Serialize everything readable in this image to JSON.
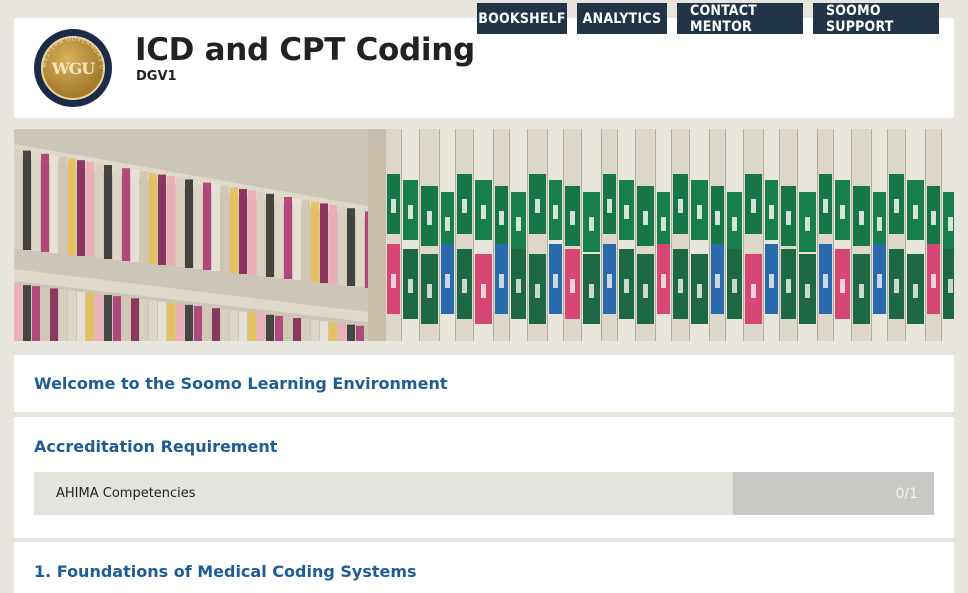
{
  "nav": {
    "bookshelf": "BOOKSHELF",
    "analytics": "ANALYTICS",
    "contact_mentor": "CONTACT MENTOR",
    "support": "SOOMO SUPPORT"
  },
  "header": {
    "logo_letters": "WGU",
    "logo_ring_text": "WESTERN GOVERNORS UNIVERSITY",
    "logo_url_text": "www.wgu.edu",
    "title": "ICD and CPT Coding",
    "course_code": "DGV1"
  },
  "banner": {
    "image": "medical-records-shelf-photo"
  },
  "sections": {
    "welcome": {
      "title": "Welcome to the Soomo Learning Environment"
    },
    "accreditation": {
      "title": "Accreditation Requirement",
      "item_label": "AHIMA Competencies",
      "progress": "0/1"
    },
    "foundations": {
      "title": "1. Foundations of Medical Coding Systems"
    }
  },
  "colors": {
    "nav_bg": "#223448",
    "section_title": "#1d5d94",
    "page_bg": "#e7e5dd"
  }
}
